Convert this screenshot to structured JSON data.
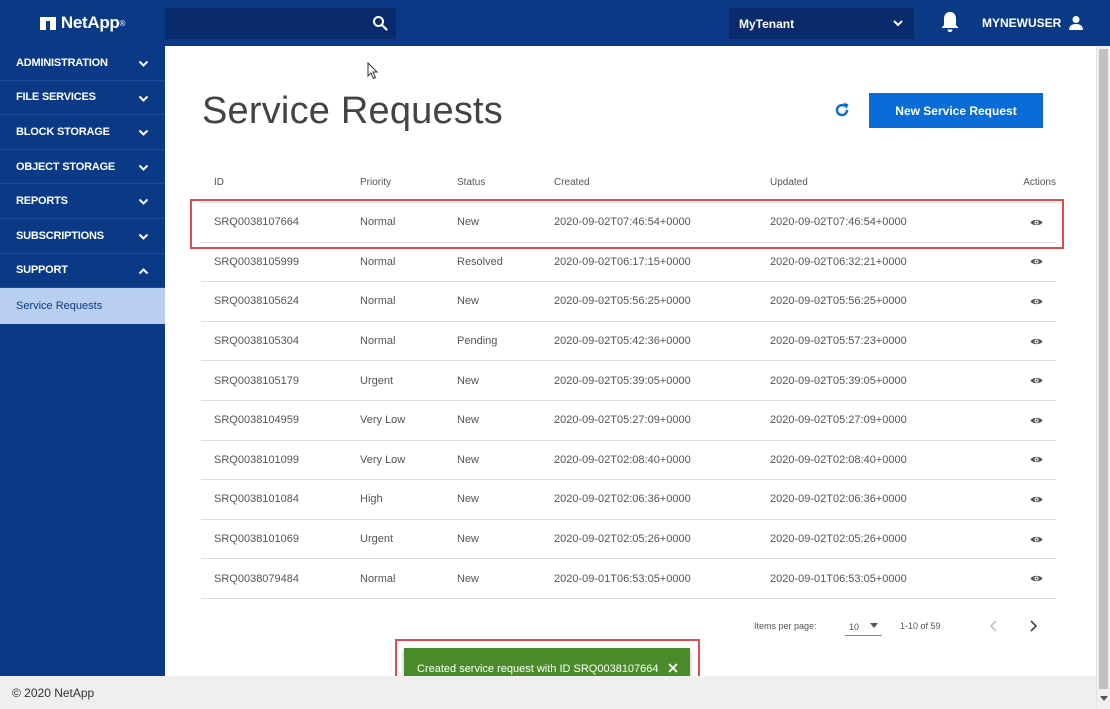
{
  "header": {
    "brand": "NetApp",
    "brand_mark": "®",
    "search": {
      "value": "",
      "placeholder": ""
    },
    "tenant": "MyTenant",
    "user": "MYNEWUSER"
  },
  "sidebar": {
    "items": [
      {
        "label": "ADMINISTRATION"
      },
      {
        "label": "FILE SERVICES"
      },
      {
        "label": "BLOCK STORAGE"
      },
      {
        "label": "OBJECT STORAGE"
      },
      {
        "label": "REPORTS"
      },
      {
        "label": "SUBSCRIPTIONS"
      },
      {
        "label": "SUPPORT"
      }
    ],
    "subitem": "Service Requests"
  },
  "main": {
    "title": "Service Requests",
    "new_button": "New Service Request",
    "columns": {
      "id": "ID",
      "priority": "Priority",
      "status": "Status",
      "created": "Created",
      "updated": "Updated",
      "actions": "Actions"
    },
    "rows": [
      {
        "id": "SRQ0038107664",
        "priority": "Normal",
        "status": "New",
        "created": "2020-09-02T07:46:54+0000",
        "updated": "2020-09-02T07:46:54+0000"
      },
      {
        "id": "SRQ0038105999",
        "priority": "Normal",
        "status": "Resolved",
        "created": "2020-09-02T06:17:15+0000",
        "updated": "2020-09-02T06:32:21+0000"
      },
      {
        "id": "SRQ0038105624",
        "priority": "Normal",
        "status": "New",
        "created": "2020-09-02T05:56:25+0000",
        "updated": "2020-09-02T05:56:25+0000"
      },
      {
        "id": "SRQ0038105304",
        "priority": "Normal",
        "status": "Pending",
        "created": "2020-09-02T05:42:36+0000",
        "updated": "2020-09-02T05:57:23+0000"
      },
      {
        "id": "SRQ0038105179",
        "priority": "Urgent",
        "status": "New",
        "created": "2020-09-02T05:39:05+0000",
        "updated": "2020-09-02T05:39:05+0000"
      },
      {
        "id": "SRQ0038104959",
        "priority": "Very Low",
        "status": "New",
        "created": "2020-09-02T05:27:09+0000",
        "updated": "2020-09-02T05:27:09+0000"
      },
      {
        "id": "SRQ0038101099",
        "priority": "Very Low",
        "status": "New",
        "created": "2020-09-02T02:08:40+0000",
        "updated": "2020-09-02T02:08:40+0000"
      },
      {
        "id": "SRQ0038101084",
        "priority": "High",
        "status": "New",
        "created": "2020-09-02T02:06:36+0000",
        "updated": "2020-09-02T02:06:36+0000"
      },
      {
        "id": "SRQ0038101069",
        "priority": "Urgent",
        "status": "New",
        "created": "2020-09-02T02:05:26+0000",
        "updated": "2020-09-02T02:05:26+0000"
      },
      {
        "id": "SRQ0038079484",
        "priority": "Normal",
        "status": "New",
        "created": "2020-09-01T06:53:05+0000",
        "updated": "2020-09-01T06:53:05+0000"
      }
    ],
    "paginator": {
      "label": "Items per page:",
      "page_size": "10",
      "range": "1-10 of 59"
    }
  },
  "toast": {
    "message": "Created service request with ID SRQ0038107664"
  },
  "footer": {
    "copyright": "© 2020 NetApp"
  },
  "colors": {
    "header_bg": "#0a3a86",
    "primary_button": "#0a6cd6",
    "toast_bg": "#4a8c2a",
    "highlight": "#e14b4b",
    "active_subitem": "#b9cff0"
  },
  "icons": [
    "search-icon",
    "chevron-down-icon",
    "bell-icon",
    "user-icon",
    "chevron-up-icon",
    "refresh-icon",
    "eye-icon",
    "chevron-left-icon",
    "chevron-right-icon",
    "close-icon"
  ]
}
